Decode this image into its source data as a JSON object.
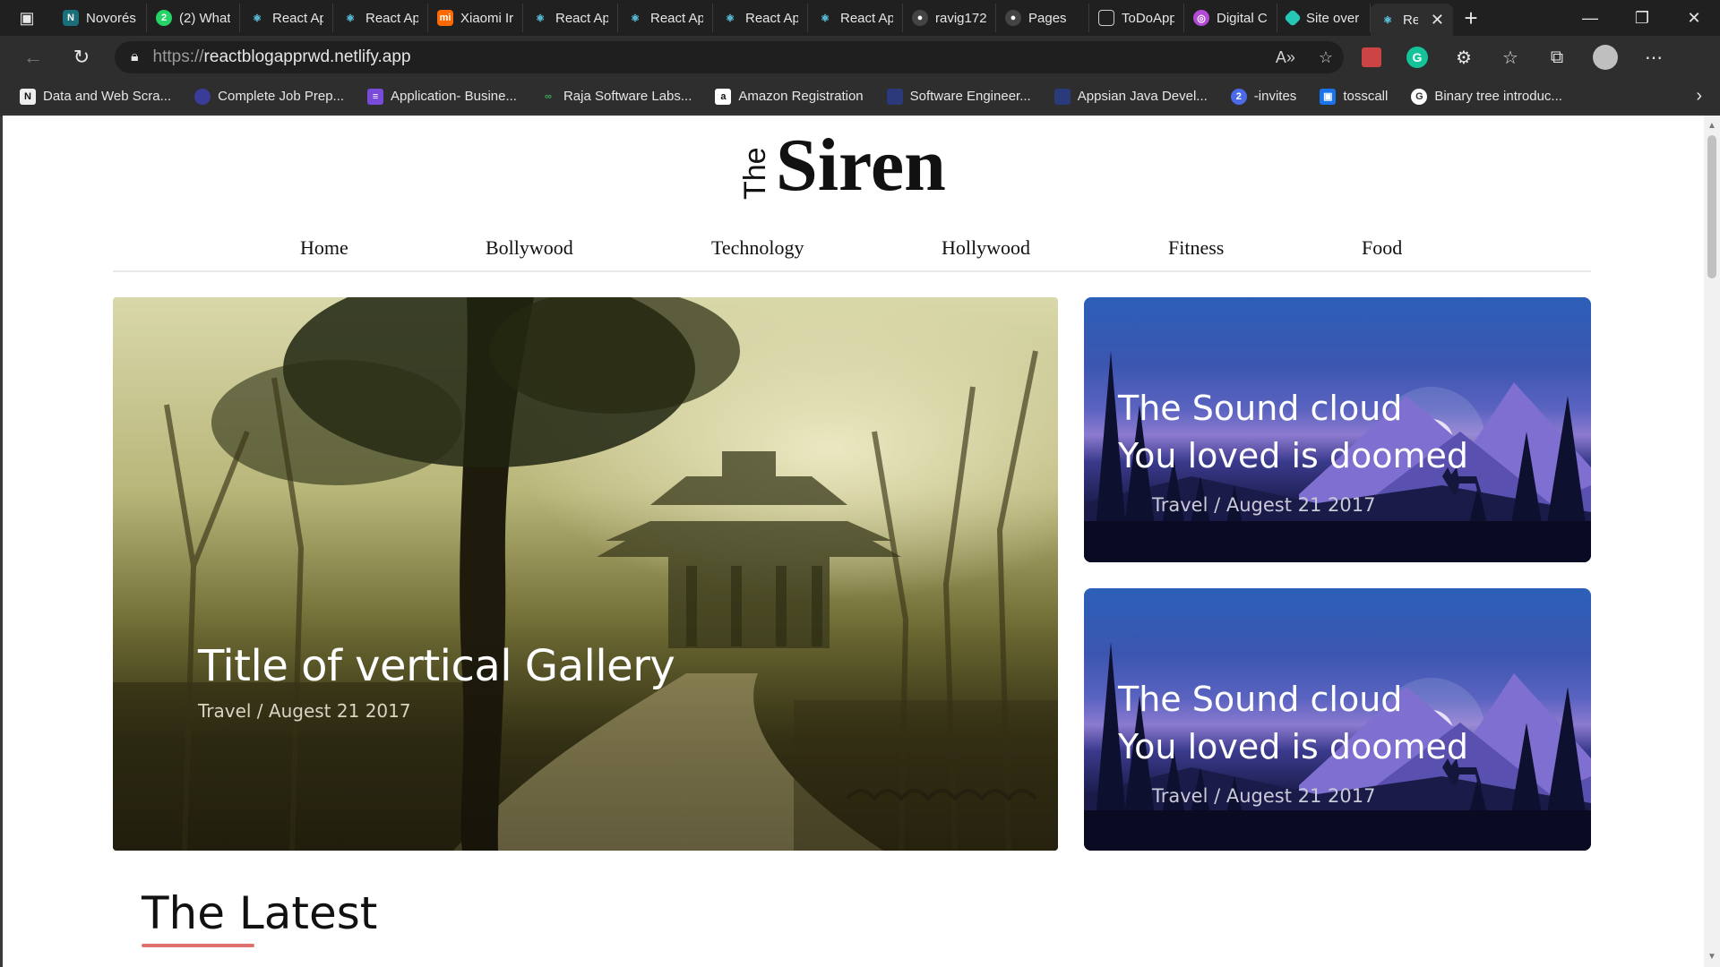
{
  "browser": {
    "tabs": [
      {
        "title": "Novorés",
        "icon": "notion-icon",
        "color": "#1a6f7a"
      },
      {
        "title": "(2) What",
        "icon": "whatsapp-icon",
        "color": "#25d366"
      },
      {
        "title": "React Ap",
        "icon": "react-icon",
        "color": "#61dafb"
      },
      {
        "title": "React Ap",
        "icon": "react-icon",
        "color": "#61dafb"
      },
      {
        "title": "Xiaomi Ir",
        "icon": "xiaomi-icon",
        "color": "#ff6900"
      },
      {
        "title": "React Ap",
        "icon": "react-icon",
        "color": "#61dafb"
      },
      {
        "title": "React Ap",
        "icon": "react-icon",
        "color": "#61dafb"
      },
      {
        "title": "React Ap",
        "icon": "react-icon",
        "color": "#61dafb"
      },
      {
        "title": "React Ap",
        "icon": "react-icon",
        "color": "#61dafb"
      },
      {
        "title": "ravig172",
        "icon": "github-icon",
        "color": "#444444"
      },
      {
        "title": "Pages",
        "icon": "github-icon",
        "color": "#444444"
      },
      {
        "title": "ToDoApp",
        "icon": "document-icon",
        "color": "#666666"
      },
      {
        "title": "Digital C",
        "icon": "digital-icon",
        "color": "#b44ad8"
      },
      {
        "title": "Site over",
        "icon": "netlify-icon",
        "color": "#25c7b7"
      },
      {
        "title": "Reac",
        "icon": "react-icon",
        "color": "#61dafb",
        "active": true
      }
    ],
    "url_protocol": "https://",
    "url_host": "reactblogapprwd.netlify.app",
    "bookmarks": [
      {
        "title": "Data and Web Scra...",
        "icon": "notion-icon",
        "color": "#333333"
      },
      {
        "title": "Complete Job Prep...",
        "icon": "moon-icon",
        "color": "#3b3b9a"
      },
      {
        "title": "Application- Busine...",
        "icon": "list-icon",
        "color": "#7a4ad8"
      },
      {
        "title": "Raja Software Labs...",
        "icon": "link-icon",
        "color": "#3aa655"
      },
      {
        "title": "Amazon Registration",
        "icon": "amazon-icon",
        "color": "#222222"
      },
      {
        "title": "Software Engineer...",
        "icon": "company-icon",
        "color": "#2a3a7a"
      },
      {
        "title": "Appsian Java Devel...",
        "icon": "company-icon",
        "color": "#2a3a7a"
      },
      {
        "title": "-invites",
        "icon": "pin-icon",
        "color": "#d93025"
      },
      {
        "title": "tosscall",
        "icon": "tosscall-icon",
        "color": "#1a73e8"
      },
      {
        "title": "Binary tree introduc...",
        "icon": "google-icon",
        "color": "#ffffff"
      }
    ]
  },
  "site": {
    "logo_small": "The",
    "logo_big": "Siren",
    "nav": [
      "Home",
      "Bollywood",
      "Technology",
      "Hollywood",
      "Fitness",
      "Food"
    ],
    "hero": {
      "title": "Title of vertical Gallery",
      "meta": "Travel / Augest 21 2017"
    },
    "side_cards": [
      {
        "line1": "The Sound cloud",
        "line2": "You loved is doomed",
        "meta": "Travel / Augest 21 2017"
      },
      {
        "line1": "The Sound cloud",
        "line2": "You loved is doomed",
        "meta": "Travel / Augest 21 2017"
      }
    ],
    "section_title": "The Latest",
    "accent_color": "#e07070"
  }
}
